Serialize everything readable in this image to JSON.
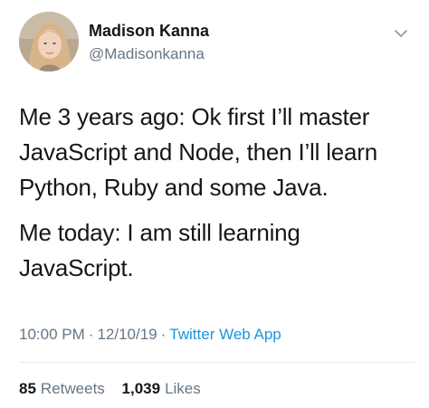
{
  "author": {
    "display_name": "Madison Kanna",
    "handle": "@Madisonkanna",
    "avatar_icon": "profile-photo"
  },
  "menu_icon": "chevron-down-icon",
  "tweet": {
    "paragraph1": [
      "Me 3 years ago: Ok first I’ll master",
      "JavaScript and Node, then I’ll learn",
      "Python, Ruby and some Java."
    ],
    "paragraph2": [
      "Me today: I am still learning",
      "JavaScript."
    ]
  },
  "meta": {
    "time": "10:00 PM",
    "separator": "·",
    "date": "12/10/19",
    "app": "Twitter Web App"
  },
  "stats": {
    "retweets_count": "85",
    "retweets_label": "Retweets",
    "likes_count": "1,039",
    "likes_label": "Likes"
  },
  "colors": {
    "text": "#14171a",
    "secondary": "#657786",
    "link": "#1b95e0",
    "divider": "#e6ecf0"
  }
}
